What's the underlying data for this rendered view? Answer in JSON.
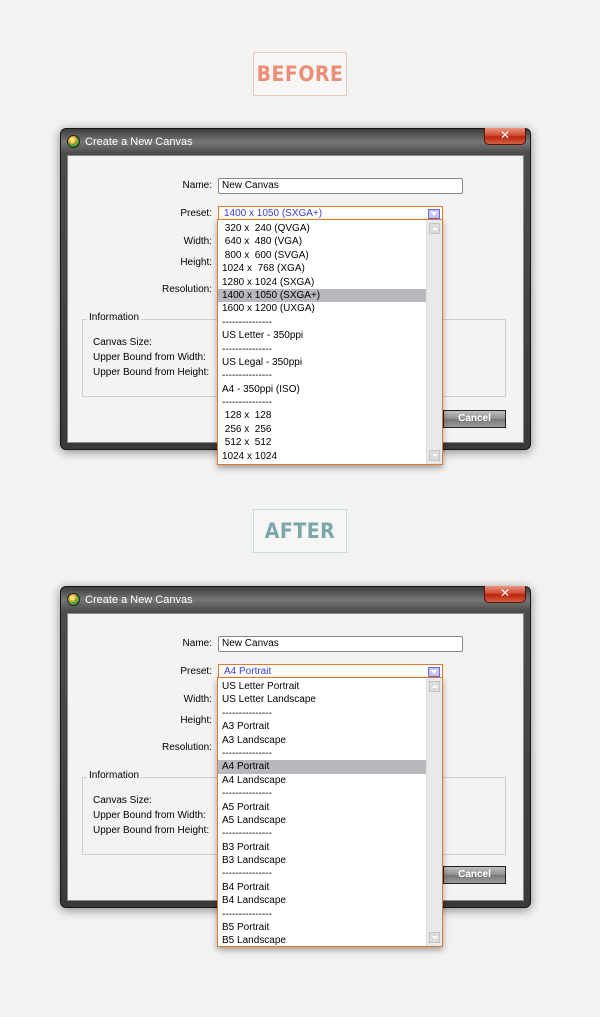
{
  "before_label": "BEFORE",
  "after_label": "AFTER",
  "window": {
    "title": "Create a New Canvas",
    "close": "✕",
    "name_label": "Name:",
    "name_value": "New Canvas",
    "preset_label": "Preset:",
    "width_label": "Width:",
    "height_label": "Height:",
    "resolution_label": "Resolution:",
    "info_title": "Information",
    "canvas_size_label": "Canvas Size:",
    "upper_width_label": "Upper Bound from Width:",
    "upper_height_label": "Upper Bound from Height:",
    "cancel_label": "Cancel"
  },
  "before": {
    "preset_value": "1400 x 1050 (SXGA+)",
    "options": [
      " 320 x  240 (QVGA)",
      " 640 x  480 (VGA)",
      " 800 x  600 (SVGA)",
      "1024 x  768 (XGA)",
      "1280 x 1024 (SXGA)",
      "1400 x 1050 (SXGA+)",
      "1600 x 1200 (UXGA)",
      "---------------",
      "US Letter - 350ppi",
      "---------------",
      "US Legal - 350ppi",
      "---------------",
      "A4 - 350ppi (ISO)",
      "---------------",
      " 128 x  128",
      " 256 x  256",
      " 512 x  512",
      "1024 x 1024"
    ],
    "selected_index": 5
  },
  "after": {
    "preset_value": "A4 Portrait",
    "options": [
      "US Letter Portrait",
      "US Letter Landscape",
      "---------------",
      "A3 Portrait",
      "A3 Landscape",
      "---------------",
      "A4 Portrait",
      "A4 Landscape",
      "---------------",
      "A5 Portrait",
      "A5 Landscape",
      "---------------",
      "B3 Portrait",
      "B3 Landscape",
      "---------------",
      "B4 Portrait",
      "B4 Landscape",
      "---------------",
      "B5 Portrait",
      "B5 Landscape"
    ],
    "selected_index": 6
  },
  "colors": {
    "accent_orange": "#e07a2f",
    "before_label": "#ec8e77",
    "after_label": "#7ba6aa",
    "selection": "#b8b8be"
  }
}
